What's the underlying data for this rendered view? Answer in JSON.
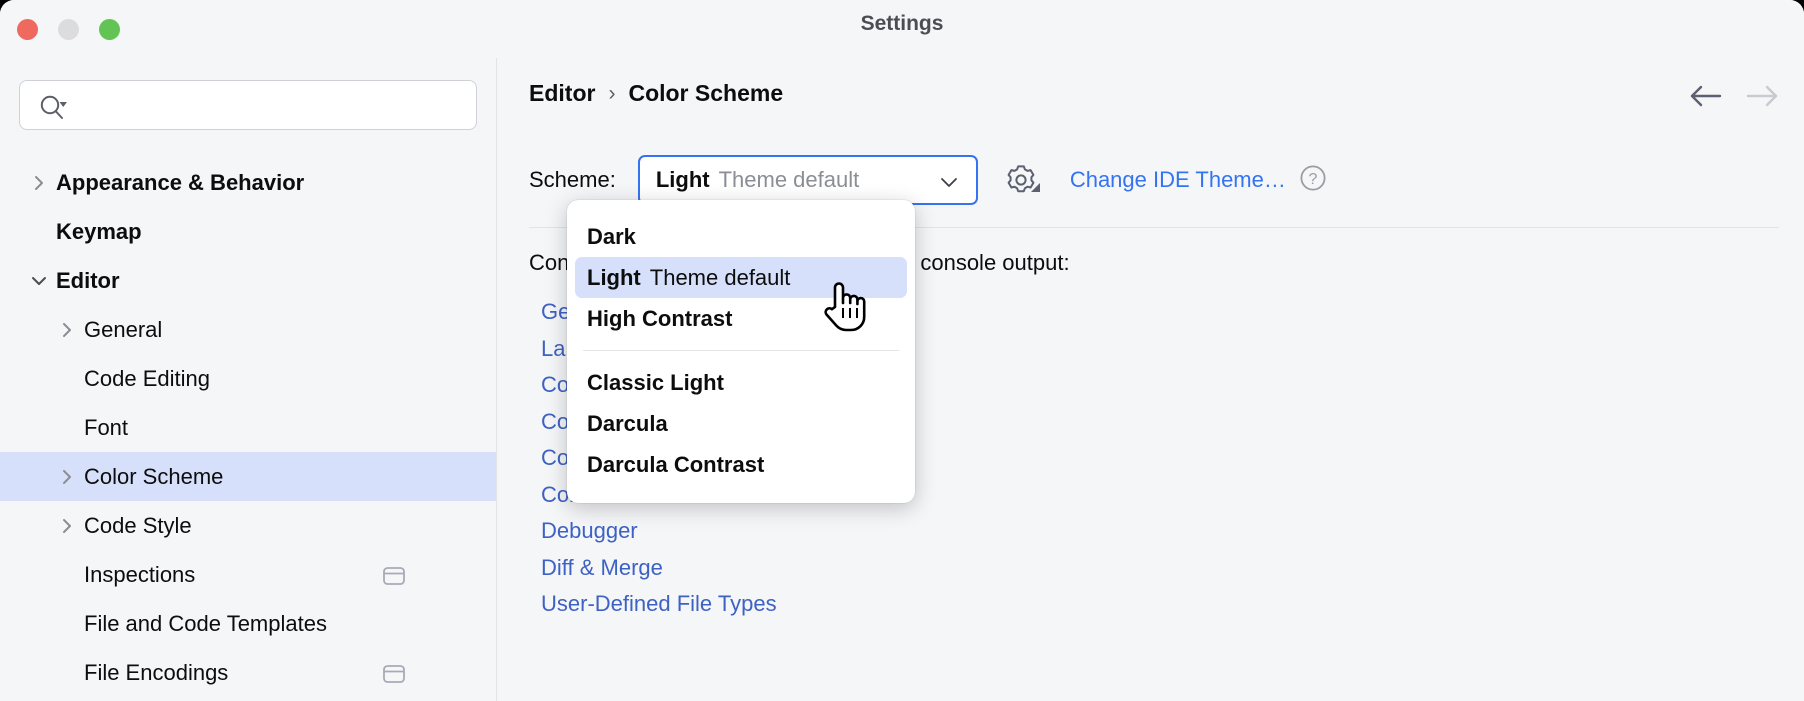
{
  "window": {
    "title": "Settings",
    "traffic_lights": [
      "close-red",
      "minimize-yellow",
      "maximize-green"
    ]
  },
  "sidebar": {
    "search": {
      "placeholder": "",
      "value": "",
      "icon": "search-icon"
    },
    "items": [
      {
        "label": "Appearance & Behavior",
        "level": 0,
        "twisty": "collapsed",
        "selected": false,
        "scope_icon": false
      },
      {
        "label": "Keymap",
        "level": 0,
        "twisty": "none",
        "selected": false,
        "scope_icon": false
      },
      {
        "label": "Editor",
        "level": 0,
        "twisty": "expanded",
        "selected": false,
        "scope_icon": false
      },
      {
        "label": "General",
        "level": 1,
        "twisty": "collapsed",
        "selected": false,
        "scope_icon": false
      },
      {
        "label": "Code Editing",
        "level": 1,
        "twisty": "none",
        "selected": false,
        "scope_icon": false
      },
      {
        "label": "Font",
        "level": 1,
        "twisty": "none",
        "selected": false,
        "scope_icon": false
      },
      {
        "label": "Color Scheme",
        "level": 1,
        "twisty": "collapsed",
        "selected": true,
        "scope_icon": false
      },
      {
        "label": "Code Style",
        "level": 1,
        "twisty": "collapsed",
        "selected": false,
        "scope_icon": false
      },
      {
        "label": "Inspections",
        "level": 1,
        "twisty": "none",
        "selected": false,
        "scope_icon": true
      },
      {
        "label": "File and Code Templates",
        "level": 1,
        "twisty": "none",
        "selected": false,
        "scope_icon": false
      },
      {
        "label": "File Encodings",
        "level": 1,
        "twisty": "none",
        "selected": false,
        "scope_icon": true
      }
    ]
  },
  "main": {
    "breadcrumb": {
      "parent": "Editor",
      "separator": "›",
      "current": "Color Scheme"
    },
    "nav": {
      "back_icon": "arrow-left-icon",
      "forward_icon": "arrow-right-icon"
    },
    "scheme": {
      "label": "Scheme:",
      "value_main": "Light",
      "value_sub": "Theme default",
      "chevron_icon": "chevron-down-icon",
      "gear_icon": "gear-icon",
      "change_theme_link": "Change IDE Theme…",
      "help_icon": "question-mark-icon",
      "focus_color": "#3574f0"
    },
    "configure_text": "Configure colors and fonts for code and console output:",
    "links": [
      "General",
      "Language Defaults",
      "Color Scheme Font",
      "Console Font",
      "Code Vision",
      "Console Colors",
      "Debugger",
      "Diff & Merge",
      "User-Defined File Types"
    ],
    "link_color": "#3e62c4"
  },
  "popup": {
    "name": "scheme-dropdown-menu",
    "items": [
      {
        "main": "Dark",
        "sub": "",
        "highlighted": false,
        "separator_after": false
      },
      {
        "main": "Light",
        "sub": "Theme default",
        "highlighted": true,
        "separator_after": false
      },
      {
        "main": "High Contrast",
        "sub": "",
        "highlighted": false,
        "separator_after": true
      },
      {
        "main": "Classic Light",
        "sub": "",
        "highlighted": false,
        "separator_after": false
      },
      {
        "main": "Darcula",
        "sub": "",
        "highlighted": false,
        "separator_after": false
      },
      {
        "main": "Darcula Contrast",
        "sub": "",
        "highlighted": false,
        "separator_after": false
      }
    ],
    "highlight_color": "#d6e0fb"
  },
  "cursor": {
    "icon": "pointing-hand-cursor"
  }
}
